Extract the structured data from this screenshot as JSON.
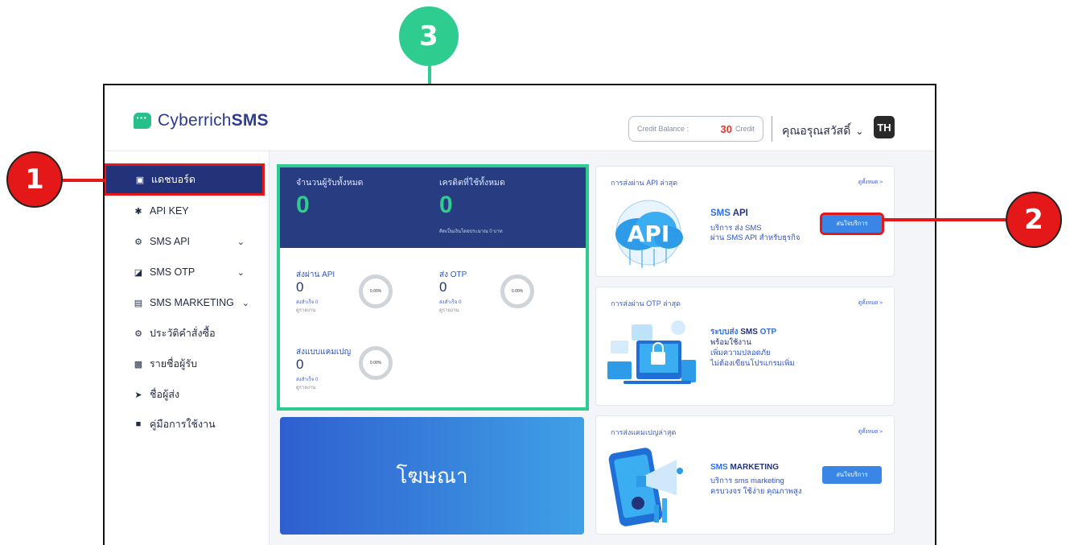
{
  "callouts": {
    "one": "1",
    "two": "2",
    "three": "3"
  },
  "header": {
    "logo_prefix": "Cyberrich",
    "logo_suffix": "SMS",
    "credit_label": "Credit Balance :",
    "credit_amount": "30",
    "credit_unit": "Credit",
    "user_name": "คุณอรุณสวัสดิ์",
    "language": "TH"
  },
  "sidebar": {
    "items": [
      {
        "label": "แดชบอร์ด",
        "icon": "dashboard-icon"
      },
      {
        "label": "API KEY",
        "icon": "key-icon"
      },
      {
        "label": "SMS API",
        "icon": "api-icon"
      },
      {
        "label": "SMS OTP",
        "icon": "otp-icon"
      },
      {
        "label": "SMS MARKETING",
        "icon": "marketing-icon"
      },
      {
        "label": "ประวัติคำสั่งซื้อ",
        "icon": "gear-icon"
      },
      {
        "label": "รายชื่อผู้รับ",
        "icon": "contacts-icon"
      },
      {
        "label": "ชื่อผู้ส่ง",
        "icon": "send-icon"
      },
      {
        "label": "คู่มือการใช้งาน",
        "icon": "book-icon"
      }
    ]
  },
  "stats": {
    "recipients_label": "จำนวนผู้รับทั้งหมด",
    "recipients_value": "0",
    "credits_label": "เครดิตที่ใช้ทั้งหมด",
    "credits_value": "0",
    "credits_note": "คิดเป็นเงินโดยประมาณ 0 บาท",
    "api": {
      "label": "ส่งผ่าน API",
      "value": "0",
      "success": "ส่งสำเร็จ 0",
      "report": "ดูรายงาน",
      "percent": "0.00%"
    },
    "otp": {
      "label": "ส่ง OTP",
      "value": "0",
      "success": "ส่งสำเร็จ 0",
      "report": "ดูรายงาน",
      "percent": "0.00%"
    },
    "campaign": {
      "label": "ส่งแบบแคมเปญ",
      "value": "0",
      "success": "ส่งสำเร็จ 0",
      "report": "ดูรายงาน",
      "percent": "0.00%"
    }
  },
  "ad": {
    "label": "โฆษณา"
  },
  "cards": {
    "api": {
      "title": "การส่งผ่าน API ล่าสุด",
      "link": "ดูทั้งหมด >",
      "heading_a": "SMS",
      "heading_b": "API",
      "desc1": "บริการ ส่ง SMS",
      "desc2": "ผ่าน SMS API สำหรับธุรกิจ",
      "button": "สนใจบริการ",
      "illustration_text": "API"
    },
    "otp": {
      "title": "การส่งผ่าน OTP ล่าสุด",
      "link": "ดูทั้งหมด >",
      "line1a": "ระบบส่ง",
      "line1b": "SMS",
      "line1c": "OTP",
      "desc1": "พร้อมใช้งาน",
      "desc2": "เพิ่มความปลอดภัย",
      "desc3": "ไม่ต้องเขียนโปรแกรมเพิ่ม"
    },
    "marketing": {
      "title": "การส่งแคมเปญล่าสุด",
      "link": "ดูทั้งหมด >",
      "heading_a": "SMS",
      "heading_b": "MARKETING",
      "desc1": "บริการ sms marketing",
      "desc2": "ครบวงจร ใช้ง่าย คุณภาพสูง",
      "button": "สนใจบริการ"
    }
  },
  "colors": {
    "brand": "#2b3c8f",
    "accent_green": "#2ecc8f",
    "annotation_red": "#e41818",
    "credit_red": "#e0332b"
  }
}
